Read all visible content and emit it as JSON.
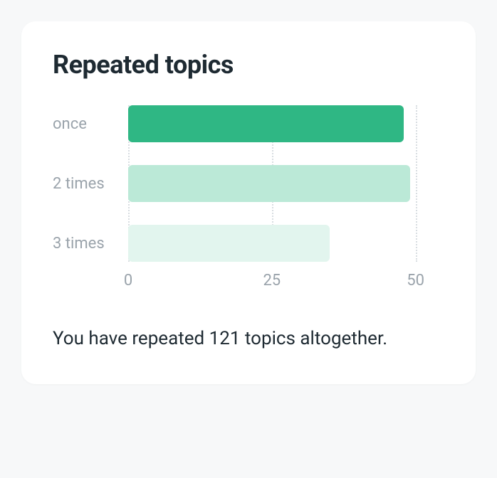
{
  "title": "Repeated topics",
  "summary": "You have repeated 121 topics altogether.",
  "chart_data": {
    "type": "bar",
    "categories": [
      "once",
      "2 times",
      "3 times"
    ],
    "values": [
      48,
      49,
      35
    ],
    "colors": [
      "#2fb784",
      "#bbe9d7",
      "#e2f5ee"
    ],
    "xlabel": "",
    "ylabel": "",
    "title": "Repeated topics",
    "xlim": [
      0,
      55
    ],
    "ticks": [
      0,
      25,
      50
    ]
  }
}
